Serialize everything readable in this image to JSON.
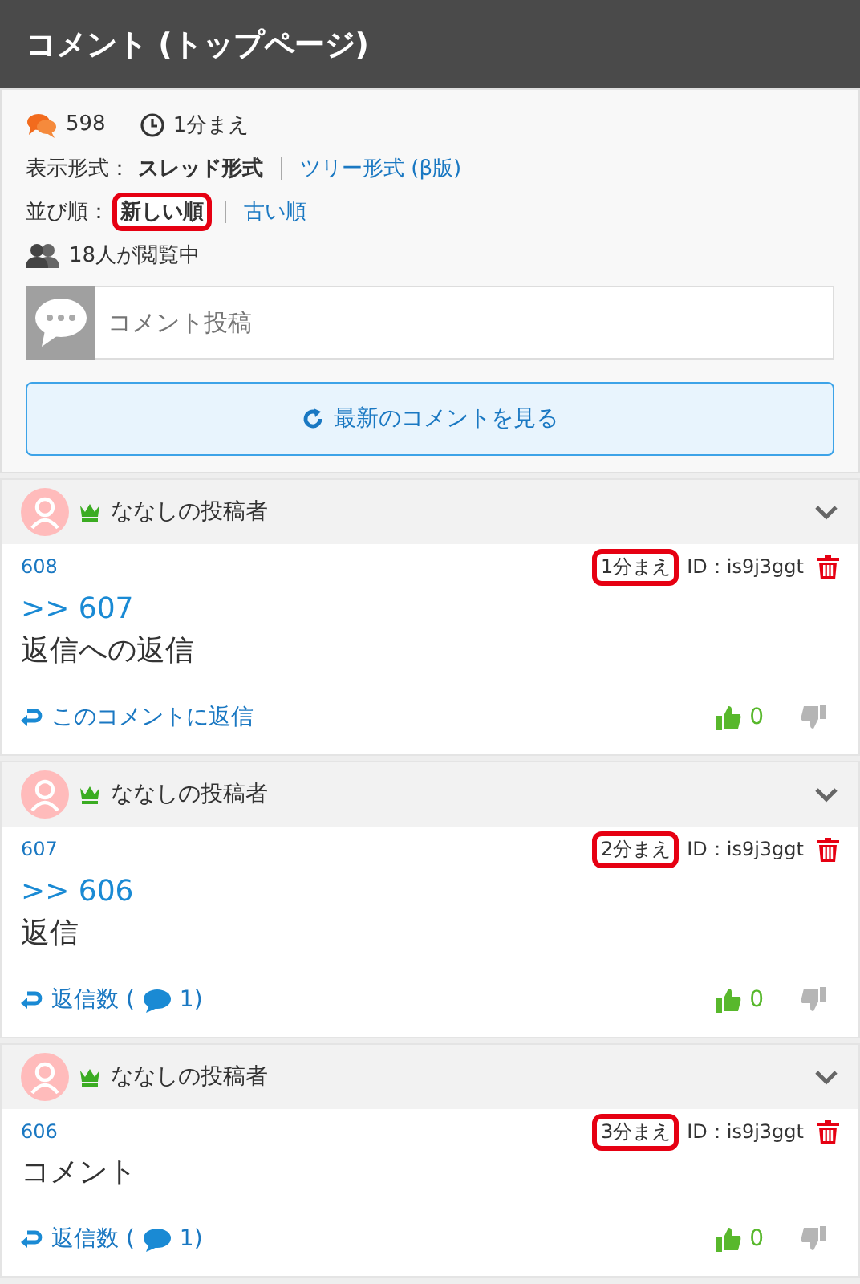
{
  "header": {
    "title": "コメント (トップページ)"
  },
  "stats": {
    "count": "598",
    "time": "1分まえ"
  },
  "display": {
    "label": "表示形式：",
    "options": [
      {
        "label": "スレッド形式",
        "selected": true
      },
      {
        "label": "ツリー形式 (β版)",
        "selected": false
      }
    ]
  },
  "sort": {
    "label": "並び順：",
    "options": [
      {
        "label": "新しい順",
        "selected": true,
        "highlighted": true
      },
      {
        "label": "古い順",
        "selected": false,
        "highlighted": false
      }
    ]
  },
  "viewers": "18人が閲覧中",
  "post": {
    "placeholder": "コメント投稿"
  },
  "refresh_button": "最新のコメントを見る",
  "comments": [
    {
      "author": "ななしの投稿者",
      "number": "608",
      "time": "1分まえ",
      "time_highlighted": true,
      "id": "ID：is9j3ggt",
      "anchor": ">> 607",
      "body": "返信への返信",
      "footer": {
        "kind": "reply",
        "label": "このコメントに返信"
      },
      "likes": "0"
    },
    {
      "author": "ななしの投稿者",
      "number": "607",
      "time": "2分まえ",
      "time_highlighted": true,
      "id": "ID：is9j3ggt",
      "anchor": ">> 606",
      "body": "返信",
      "footer": {
        "kind": "count",
        "label": "返信数 (",
        "count": "1)"
      },
      "likes": "0"
    },
    {
      "author": "ななしの投稿者",
      "number": "606",
      "time": "3分まえ",
      "time_highlighted": true,
      "id": "ID：is9j3ggt",
      "body": "コメント",
      "footer": {
        "kind": "count",
        "label": "返信数 (",
        "count": "1)"
      },
      "likes": "0"
    }
  ]
}
